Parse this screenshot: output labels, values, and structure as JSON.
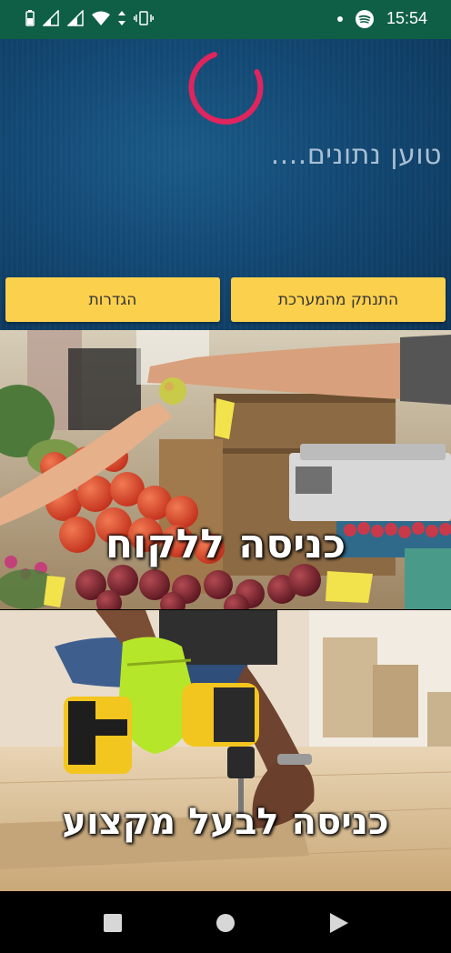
{
  "status_bar": {
    "time": "15:54",
    "icons": [
      "battery-icon",
      "signal-icon",
      "signal-icon",
      "wifi-icon",
      "data-arrows-icon",
      "vibrate-icon",
      "notification-dot-icon",
      "spotify-icon"
    ]
  },
  "header": {
    "loading_text": "טוען נתונים....",
    "spinner_color": "#e0245e"
  },
  "buttons": {
    "disconnect": "התנתק מהמערכת",
    "settings": "הגדרות",
    "color": "#fbd04d"
  },
  "cards": {
    "customer": {
      "label": "כניסה ללקוח"
    },
    "professional": {
      "label": "כניסה לבעל מקצוע"
    }
  },
  "nav_bar": {
    "icons": [
      "recents-square-icon",
      "home-circle-icon",
      "back-triangle-icon"
    ]
  }
}
